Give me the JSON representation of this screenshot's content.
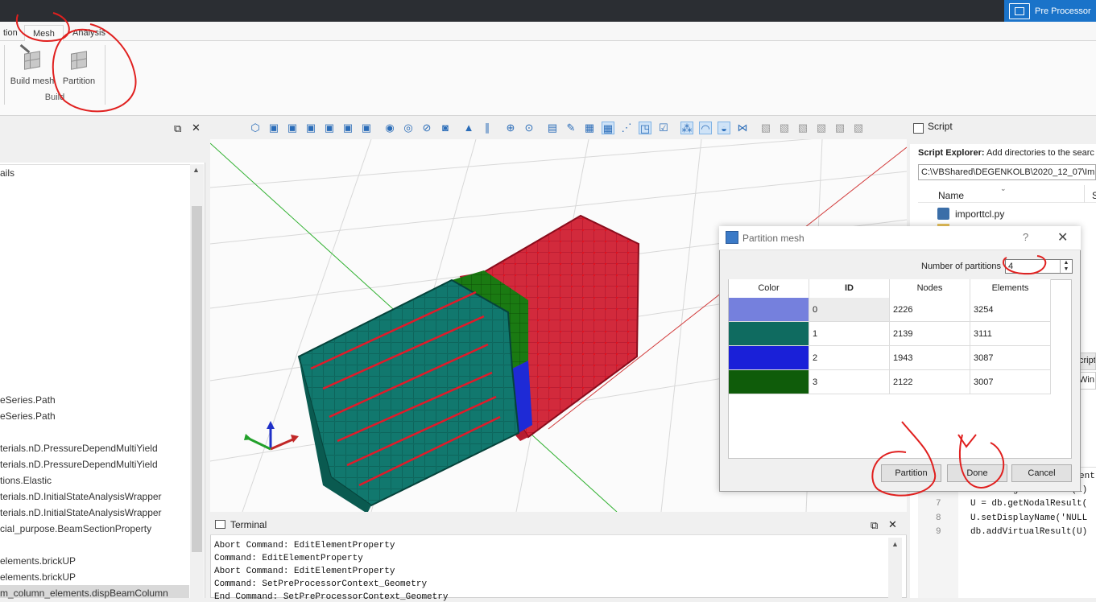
{
  "app": {
    "mode_button": "Pre Processor"
  },
  "menu_tabs": [
    {
      "label": "tion"
    },
    {
      "label": "Mesh"
    },
    {
      "label": "Analysis"
    }
  ],
  "ribbon": {
    "build_mesh_label": "Build mesh",
    "partition_label": "Partition",
    "group_label": "Build"
  },
  "left_panel": {
    "header": "ails",
    "items": [
      "eSeries.Path",
      "eSeries.Path",
      "terials.nD.PressureDependMultiYield",
      "terials.nD.PressureDependMultiYield",
      "tions.Elastic",
      "terials.nD.InitialStateAnalysisWrapper",
      "terials.nD.InitialStateAnalysisWrapper",
      "cial_purpose.BeamSectionProperty",
      "elements.brickUP",
      "elements.brickUP",
      "m_column_elements.dispBeamColumn"
    ]
  },
  "terminal": {
    "title": "Terminal",
    "lines": [
      "Abort Command: EditElementProperty",
      "Command: EditElementProperty",
      "Abort Command: EditElementProperty",
      "Command: SetPreProcessorContext_Geometry",
      "End Command: SetPreProcessorContext_Geometry"
    ]
  },
  "script_panel": {
    "title": "Script",
    "explorer_label": "Script Explorer:",
    "explorer_hint": "Add directories to the searc",
    "path": "C:\\VBShared\\DEGENKOLB\\2020_12_07\\Impor",
    "col_name": "Name",
    "col_s": "S",
    "file": "importtcl.py",
    "side_a": "cript",
    "side_b": "Win",
    "code": [
      {
        "ln": "",
        "tx": "ent"
      },
      {
        "ln": "",
        "tx": "db = db.getDatabase(1)"
      },
      {
        "ln": "7",
        "tx": "U = db.getNodalResult("
      },
      {
        "ln": "8",
        "tx": "U.setDisplayName('NULL"
      },
      {
        "ln": "9",
        "tx": "db.addVirtualResult(U)"
      }
    ]
  },
  "dialog": {
    "title": "Partition mesh",
    "help": "?",
    "close": "✕",
    "num_partitions_label": "Number of partitions",
    "num_partitions_value": "4",
    "columns": [
      "Color",
      "ID",
      "Nodes",
      "Elements"
    ],
    "rows": [
      {
        "color": "#7580dd",
        "id": "0",
        "nodes": "2226",
        "elements": "3254"
      },
      {
        "color": "#0f6b60",
        "id": "1",
        "nodes": "2139",
        "elements": "3111"
      },
      {
        "color": "#1a20d8",
        "id": "2",
        "nodes": "1943",
        "elements": "3087"
      },
      {
        "color": "#0f5c0a",
        "id": "3",
        "nodes": "2122",
        "elements": "3007"
      }
    ],
    "btn_partition": "Partition",
    "btn_done": "Done",
    "btn_cancel": "Cancel"
  },
  "colors": {
    "mesh_red": "#d22a3c",
    "mesh_teal": "#11786e",
    "mesh_green": "#1a7a12",
    "mesh_blue": "#1e2ad6",
    "annotation_red": "#e0201f"
  }
}
